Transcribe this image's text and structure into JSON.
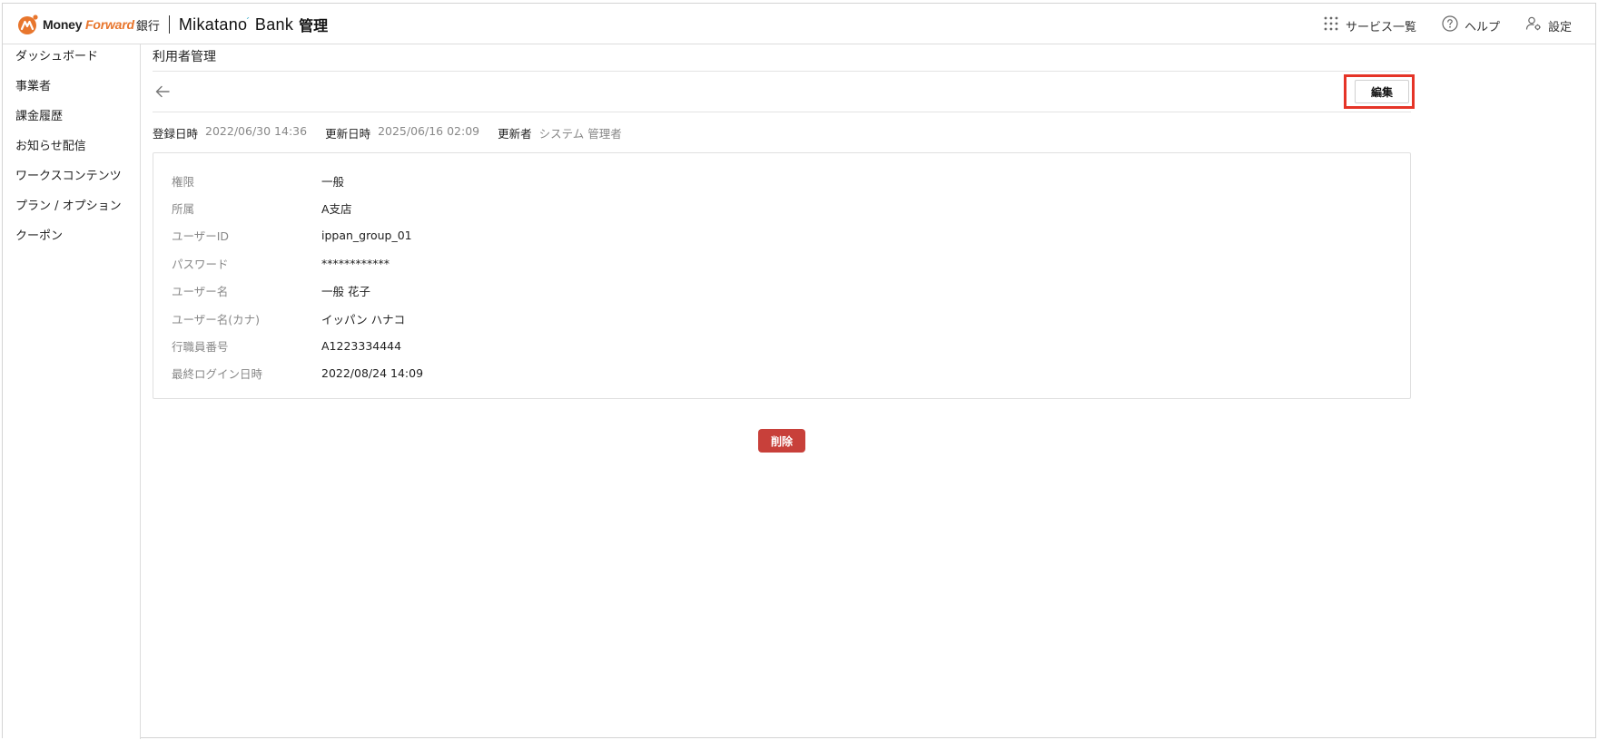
{
  "header": {
    "brand": {
      "money": "Money ",
      "forward": "Forward",
      "bank": "銀行",
      "mikatano": "Mikatano",
      "bank_en": " Bank",
      "admin": "管理"
    },
    "nav": {
      "services": "サービス一覧",
      "help": "ヘルプ",
      "settings": "設定"
    }
  },
  "sidebar": {
    "items": [
      {
        "label": "ダッシュボード"
      },
      {
        "label": "事業者"
      },
      {
        "label": "課金履歴"
      },
      {
        "label": "お知らせ配信"
      },
      {
        "label": "ワークスコンテンツ"
      },
      {
        "label": "プラン / オプション"
      },
      {
        "label": "クーポン"
      }
    ]
  },
  "main": {
    "title": "利用者管理",
    "edit_label": "編集",
    "meta": {
      "created_label": "登録日時",
      "created_value": "2022/06/30 14:36",
      "updated_label": "更新日時",
      "updated_value": "2025/06/16 02:09",
      "updater_label": "更新者",
      "updater_value": "システム 管理者"
    },
    "details": [
      {
        "label": "権限",
        "value": "一般"
      },
      {
        "label": "所属",
        "value": "A支店"
      },
      {
        "label": "ユーザーID",
        "value": "ippan_group_01"
      },
      {
        "label": "パスワード",
        "value": "************"
      },
      {
        "label": "ユーザー名",
        "value": "一般 花子"
      },
      {
        "label": "ユーザー名(カナ)",
        "value": "イッパン ハナコ"
      },
      {
        "label": "行職員番号",
        "value": "A1223334444"
      },
      {
        "label": "最終ログイン日時",
        "value": "2022/08/24 14:09"
      }
    ],
    "delete_label": "削除"
  },
  "colors": {
    "brand_orange": "#e8762d",
    "highlight_red": "#e53427",
    "delete_red": "#c8403a"
  }
}
